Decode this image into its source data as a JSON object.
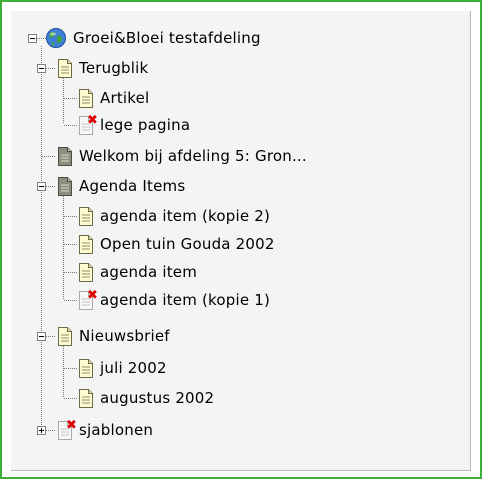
{
  "tree": {
    "root": {
      "label": "Groei&Bloei testafdeling",
      "icon": "globe-icon",
      "expanded": true
    },
    "nodes": [
      {
        "label": "Terugblik",
        "icon": "page-icon",
        "expanded": true
      },
      {
        "label": "Artikel",
        "icon": "page-icon"
      },
      {
        "label": "lege pagina",
        "icon": "deleted-page-icon"
      },
      {
        "label": "Welkom bij afdeling 5: Gron...",
        "icon": "grey-page-icon"
      },
      {
        "label": "Agenda Items",
        "icon": "grey-page-icon",
        "expanded": true
      },
      {
        "label": "agenda item (kopie 2)",
        "icon": "page-icon"
      },
      {
        "label": "Open tuin Gouda 2002",
        "icon": "page-icon"
      },
      {
        "label": "agenda item",
        "icon": "page-icon"
      },
      {
        "label": "agenda item (kopie 1)",
        "icon": "deleted-page-icon"
      },
      {
        "label": "Nieuwsbrief",
        "icon": "page-icon",
        "expanded": true
      },
      {
        "label": "juli 2002",
        "icon": "page-icon"
      },
      {
        "label": "augustus 2002",
        "icon": "page-icon"
      },
      {
        "label": "sjablonen",
        "icon": "deleted-page-icon",
        "expanded": false
      }
    ]
  },
  "colors": {
    "frame": "#3fae3a",
    "panel": "#f4f4f4",
    "page_fill": "#fffbd0",
    "grey_page_fill": "#8e8e80",
    "delete_mark": "#e00000"
  }
}
